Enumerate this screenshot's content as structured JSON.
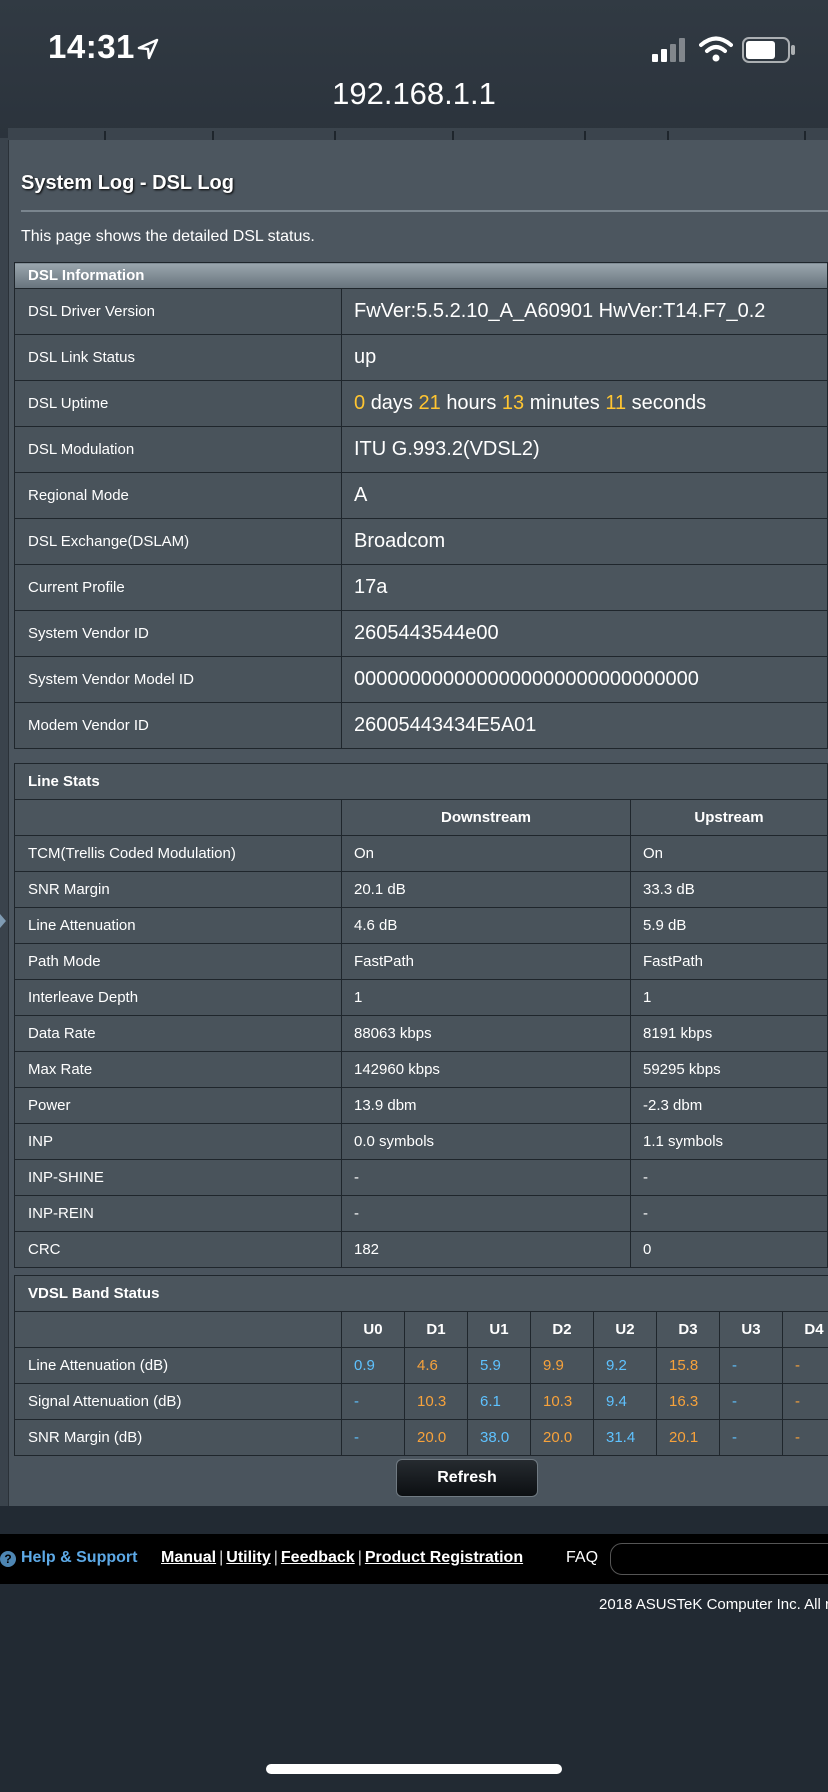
{
  "status_bar": {
    "time": "14:31"
  },
  "address_bar": {
    "url": "192.168.1.1"
  },
  "page": {
    "title": "System Log - DSL Log",
    "description": "This page shows the detailed DSL status."
  },
  "dsl_info": {
    "heading": "DSL Information",
    "rows": [
      {
        "label": "DSL Driver Version",
        "value": "FwVer:5.5.2.10_A_A60901 HwVer:T14.F7_0.2"
      },
      {
        "label": "DSL Link Status",
        "value": "up"
      },
      {
        "label": "DSL Uptime",
        "uptime": {
          "days": "0",
          "days_unit": "days",
          "hours": "21",
          "hours_unit": "hours",
          "minutes": "13",
          "minutes_unit": "minutes",
          "seconds": "11",
          "seconds_unit": "seconds"
        }
      },
      {
        "label": "DSL Modulation",
        "value": "ITU G.993.2(VDSL2)"
      },
      {
        "label": "Regional Mode",
        "value": "A"
      },
      {
        "label": "DSL Exchange(DSLAM)",
        "value": "Broadcom"
      },
      {
        "label": "Current Profile",
        "value": "17a"
      },
      {
        "label": "System Vendor ID",
        "value": "2605443544e00"
      },
      {
        "label": "System Vendor Model ID",
        "value": "0000000000000000000000000000000"
      },
      {
        "label": "Modem Vendor ID",
        "value": "26005443434E5A01"
      }
    ]
  },
  "line_stats": {
    "heading": "Line Stats",
    "col_down": "Downstream",
    "col_up": "Upstream",
    "rows": [
      {
        "label": "TCM(Trellis Coded Modulation)",
        "down": "On",
        "up": "On"
      },
      {
        "label": "SNR Margin",
        "down": "20.1 dB",
        "up": "33.3 dB"
      },
      {
        "label": "Line Attenuation",
        "down": "4.6 dB",
        "up": "5.9 dB"
      },
      {
        "label": "Path Mode",
        "down": "FastPath",
        "up": "FastPath"
      },
      {
        "label": "Interleave Depth",
        "down": "1",
        "up": "1"
      },
      {
        "label": "Data Rate",
        "down": "88063 kbps",
        "up": "8191 kbps"
      },
      {
        "label": "Max Rate",
        "down": "142960 kbps",
        "up": "59295 kbps"
      },
      {
        "label": "Power",
        "down": "13.9 dbm",
        "up": "-2.3 dbm"
      },
      {
        "label": "INP",
        "down": "0.0 symbols",
        "up": "1.1 symbols"
      },
      {
        "label": "INP-SHINE",
        "down": "-",
        "up": "-"
      },
      {
        "label": "INP-REIN",
        "down": "-",
        "up": "-"
      },
      {
        "label": "CRC",
        "down": "182",
        "up": "0"
      }
    ]
  },
  "band_status": {
    "heading": "VDSL Band Status",
    "columns": [
      "U0",
      "D1",
      "U1",
      "D2",
      "U2",
      "D3",
      "U3",
      "D4"
    ],
    "rows": [
      {
        "label": "Line Attenuation (dB)",
        "values": [
          "0.9",
          "4.6",
          "5.9",
          "9.9",
          "9.2",
          "15.8",
          "-",
          "-"
        ]
      },
      {
        "label": "Signal Attenuation (dB)",
        "values": [
          "-",
          "10.3",
          "6.1",
          "10.3",
          "9.4",
          "16.3",
          "-",
          "-"
        ]
      },
      {
        "label": "SNR Margin (dB)",
        "values": [
          "-",
          "20.0",
          "38.0",
          "20.0",
          "31.4",
          "20.1",
          "-",
          "-"
        ]
      }
    ]
  },
  "buttons": {
    "refresh": "Refresh"
  },
  "footer": {
    "help": "Help & Support",
    "links": [
      "Manual",
      "Utility",
      "Feedback",
      "Product Registration"
    ],
    "separator": "|",
    "faq": "FAQ",
    "copyright": "2018 ASUSTeK Computer Inc. All r"
  },
  "colors": {
    "upstream_value": "#5ec2ff",
    "downstream_value": "#f7a23b",
    "uptime_number": "#ffc531"
  }
}
